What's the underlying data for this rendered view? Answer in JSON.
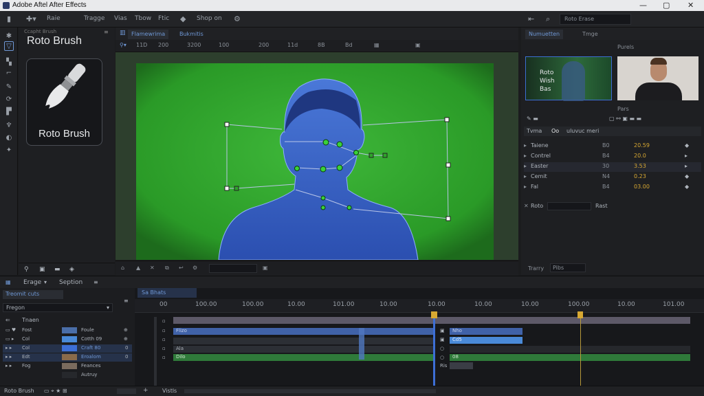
{
  "app": {
    "title": "Adobe Aftel After Effects"
  },
  "window_controls": {
    "minimize": "—",
    "maximize": "▢",
    "close": "✕"
  },
  "menu": {
    "items": [
      "Raie",
      "Tragge",
      "Vias",
      "Tbow",
      "Ftic",
      "Shop on"
    ],
    "search_label": "Roto Erase"
  },
  "left_panel": {
    "tab": "Ccapht Brush",
    "title": "Roto Brush",
    "card_label": "Roto Brush"
  },
  "viewer": {
    "tabs": [
      "Flamewrima",
      "Bukmitis"
    ],
    "toolbar": [
      "11D",
      "200",
      "3200",
      "100",
      "200",
      "11d",
      "8B",
      "Bd"
    ],
    "bottom_field": ""
  },
  "right_panel": {
    "tabs": [
      "Numuetten",
      "Tmge"
    ],
    "sub_tab": "Purels",
    "thumb1_lines": [
      "Roto",
      "Wish",
      "Bas"
    ],
    "label_a": "Pars",
    "section_tabs": [
      "Tvma",
      "Oo",
      "uluvuc meri"
    ],
    "props": [
      {
        "name": "Taiene",
        "v1": "B0",
        "v2": "20.59"
      },
      {
        "name": "Contrel",
        "v1": "B4",
        "v2": "20.0"
      },
      {
        "name": "Easter",
        "v1": "30",
        "v2": "3.53"
      },
      {
        "name": "Cemit",
        "v1": "N4",
        "v2": "0.23"
      },
      {
        "name": "Fal",
        "v1": "B4",
        "v2": "03.00"
      }
    ],
    "footer_left": "Roto",
    "footer_right": "Rast",
    "bottom_left": "Trarry",
    "bottom_field": "Pibs"
  },
  "timeline": {
    "tabs": [
      "Erage",
      "Seption"
    ],
    "comp_tab": "Treomit cuts",
    "sub_tab": "Sa Bhats",
    "dropdown": "Fregon",
    "group": "Tnaen",
    "ruler": [
      "00",
      "100.00",
      "100.00",
      "10.00",
      "101.00",
      "10.00",
      "10.00",
      "10.00",
      "10.00",
      "100.00",
      "10.00",
      "101.00"
    ],
    "layers": [
      {
        "flag": "Fost",
        "thumb": "blue",
        "name": "Foule"
      },
      {
        "flag": "Col",
        "thumb": "blue",
        "name": "Cotth 09"
      },
      {
        "flag": "Col",
        "thumb": "blue",
        "name": "Craft 80"
      },
      {
        "flag": "Edt",
        "thumb": "img",
        "name": "Eroalom"
      },
      {
        "flag": "Fog",
        "thumb": "img",
        "name": "Feances"
      },
      {
        "flag": "",
        "thumb": "",
        "name": "Autruy"
      }
    ],
    "track_labels": [
      "Flizo",
      "Ala",
      "Dilo"
    ],
    "clip_labels": [
      "Nho",
      "Cd5",
      "08"
    ],
    "misc_label": "Ris"
  },
  "status": {
    "left": "Roto Brush",
    "mid": "Vistls"
  },
  "colors": {
    "accent": "#3d6fd6",
    "green_screen": "#2fa52a",
    "playhead": "#d7a832"
  }
}
